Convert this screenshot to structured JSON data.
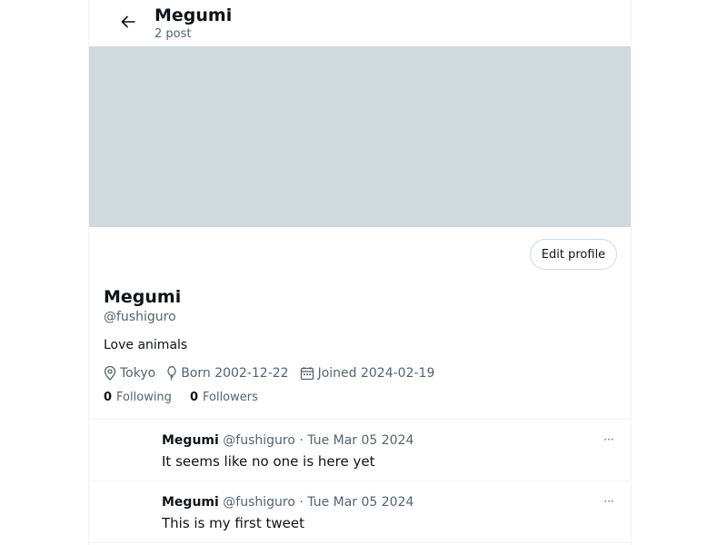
{
  "header": {
    "title": "Megumi",
    "post_count": "2 post"
  },
  "profile": {
    "edit_label": "Edit profile",
    "name": "Megumi",
    "handle": "@fushiguro",
    "bio": "Love animals",
    "location": "Tokyo",
    "born": "Born 2002-12-22",
    "joined": "Joined 2024-02-19",
    "following_count": "0",
    "following_label": "Following",
    "followers_count": "0",
    "followers_label": "Followers"
  },
  "tweets": [
    {
      "author": "Megumi",
      "handle": "@fushiguro",
      "separator": "·",
      "date": "Tue Mar 05 2024",
      "text": "It seems like no one is here yet",
      "more_label": "···"
    },
    {
      "author": "Megumi",
      "handle": "@fushiguro",
      "separator": "·",
      "date": "Tue Mar 05 2024",
      "text": "This is my first tweet",
      "more_label": "···"
    }
  ],
  "colors": {
    "banner": "#cfd9de",
    "text_primary": "#0f1419",
    "text_secondary": "#536471",
    "border": "#eff3f4"
  },
  "icons": {
    "back": "arrow-left-icon",
    "location": "location-pin-icon",
    "birthday": "balloon-icon",
    "joined": "calendar-icon",
    "more": "more-icon"
  }
}
